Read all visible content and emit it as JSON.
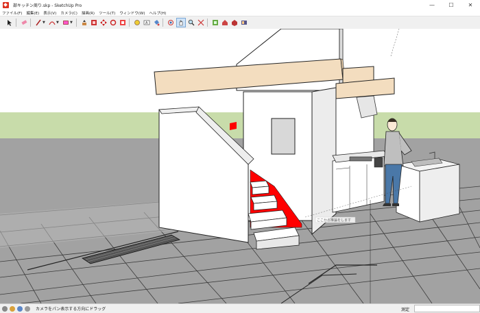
{
  "window": {
    "title": "部キッチン周り.skp - SketchUp Pro",
    "minimize": "—",
    "maximize": "☐",
    "close": "✕"
  },
  "menu": {
    "items": [
      "ファイル(F)",
      "編集(E)",
      "表示(V)",
      "カメラ(C)",
      "描画(R)",
      "ツール(T)",
      "ウィンドウ(W)",
      "ヘルプ(H)"
    ]
  },
  "toolbar": {
    "icons": [
      "select-icon",
      "eraser-icon",
      "line-icon",
      "arc-icon",
      "rectangle-icon",
      "pushpull-icon",
      "offset-icon",
      "move-icon",
      "rotate-icon",
      "scale-icon",
      "tape-measure-icon",
      "text-icon",
      "paint-bucket-icon",
      "orbit-icon",
      "pan-icon",
      "zoom-icon",
      "zoom-extents-icon",
      "components-icon",
      "warehouse-icon",
      "extension-icon",
      "layout-icon"
    ]
  },
  "viewport": {
    "inference_hint": "ここから推論をします",
    "sky_color": "#ffffff",
    "ground_color": "#a2a2a2",
    "horizon_color": "#c8dcaa"
  },
  "statusbar": {
    "hint": "カメラをパン表示する方向にドラッグ",
    "measure_label": "測定",
    "measure_value": ""
  }
}
